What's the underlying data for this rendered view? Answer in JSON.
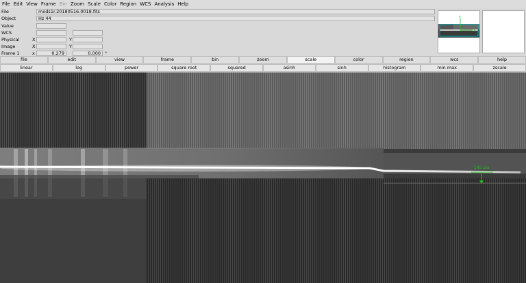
{
  "menu": [
    "File",
    "Edit",
    "View",
    "Frame",
    "Bin",
    "Zoom",
    "Scale",
    "Color",
    "Region",
    "WCS",
    "Analysis",
    "Help"
  ],
  "menu_disabled": [
    "Bin"
  ],
  "info": {
    "file_label": "File",
    "file_value": "mods1r.20180516.0018.fits",
    "object_label": "Object",
    "object_value": "Hz 44",
    "value_label": "Value",
    "wcs_label": "WCS",
    "physical_label": "Physical",
    "image_label": "Image",
    "frame_label": "Frame 1",
    "x_label": "X",
    "y_label": "Y",
    "x_lower": "x",
    "zoom_value": "0.279",
    "angle_value": "0.000",
    "degree_symbol": "°"
  },
  "buttons_main": [
    "file",
    "edit",
    "view",
    "frame",
    "bin",
    "zoom",
    "scale",
    "color",
    "region",
    "wcs",
    "help"
  ],
  "buttons_main_active": "scale",
  "buttons_scale": [
    "linear",
    "log",
    "power",
    "square root",
    "squared",
    "asinh",
    "sinh",
    "histogram",
    "min max",
    "zscale"
  ],
  "buttons_scale_active": "linear",
  "region_label": "145 pix",
  "colors": {
    "background": "#d9d9d9",
    "canvas_dark": "#3b3b3b",
    "region_green": "#19c219",
    "panner_box": "#00b0b0"
  },
  "icons": {
    "region_arrow": "green-down-arrow",
    "panner_compass": "compass-arrows"
  }
}
